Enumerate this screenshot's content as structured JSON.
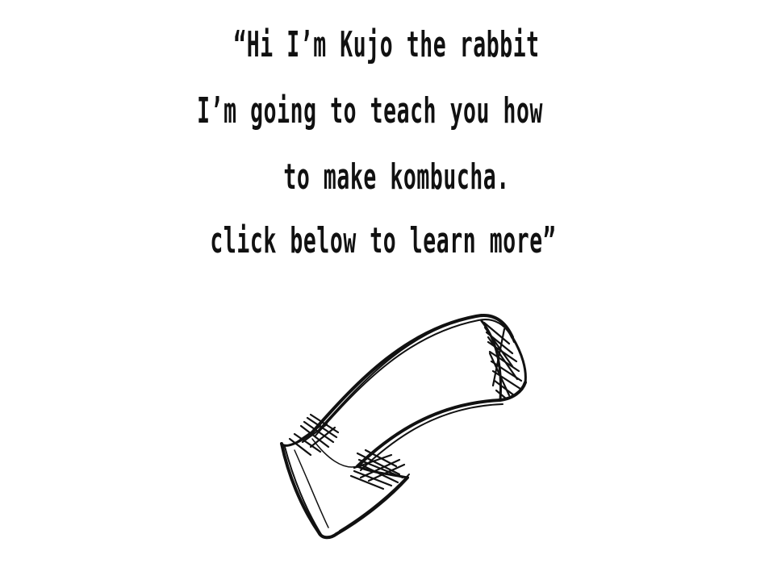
{
  "speech": {
    "lines": [
      "“Hi I’m Kujo the rabbit",
      "I’m going to teach you how",
      "to make kombucha.",
      "click below to learn more”"
    ]
  },
  "arrow": {
    "icon": "hand-drawn-curved-arrow-down-left-icon",
    "color": "#111111"
  }
}
